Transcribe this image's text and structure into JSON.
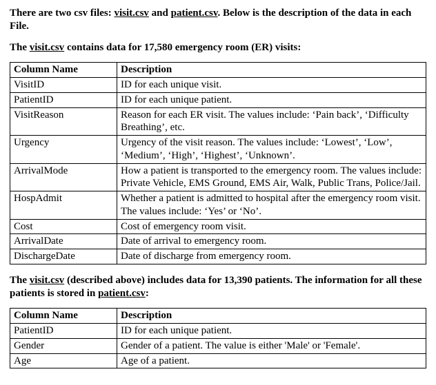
{
  "intro": {
    "prefix": "There are two csv files: ",
    "file1": "visit.csv",
    "mid": " and ",
    "file2": "patient.csv",
    "suffix": ". Below is the description of the data in each File."
  },
  "visit_heading": {
    "prefix": "The ",
    "file": "visit.csv",
    "suffix": " contains data for 17,580 emergency room (ER) visits:"
  },
  "headers": {
    "col": "Column Name",
    "desc": "Description"
  },
  "visit_rows": [
    {
      "col": "VisitID",
      "desc": "ID for each unique visit."
    },
    {
      "col": "PatientID",
      "desc": "ID for each unique patient."
    },
    {
      "col": "VisitReason",
      "desc": "Reason for each ER visit. The values include: ‘Pain back’, ‘Difficulty Breathing’, etc."
    },
    {
      "col": "Urgency",
      "desc": "Urgency of the visit reason. The values include: ‘Lowest’, ‘Low’, ‘Medium’, ‘High’, ‘Highest’, ‘Unknown’."
    },
    {
      "col": "ArrivalMode",
      "desc": "How a patient is transported to the emergency room. The values include: Private Vehicle, EMS Ground, EMS Air, Walk, Public Trans, Police/Jail."
    },
    {
      "col": "HospAdmit",
      "desc": "Whether a patient is admitted to hospital after the emergency room visit. The values include: ‘Yes’ or ‘No’."
    },
    {
      "col": "Cost",
      "desc": "Cost of emergency room visit."
    },
    {
      "col": "ArrivalDate",
      "desc": "Date of arrival to emergency room."
    },
    {
      "col": "DischargeDate",
      "desc": "Date of discharge from emergency room."
    }
  ],
  "patient_heading": {
    "prefix": "The ",
    "file": "visit.csv",
    "mid": " (described above) includes data for 13,390 patients. The information for all these patients is stored in ",
    "file2": "patient.csv",
    "suffix": ":"
  },
  "patient_rows": [
    {
      "col": "PatientID",
      "desc": "ID for each unique patient."
    },
    {
      "col": "Gender",
      "desc": "Gender of a patient. The value is either 'Male' or 'Female'."
    },
    {
      "col": "Age",
      "desc": "Age of a patient."
    }
  ]
}
